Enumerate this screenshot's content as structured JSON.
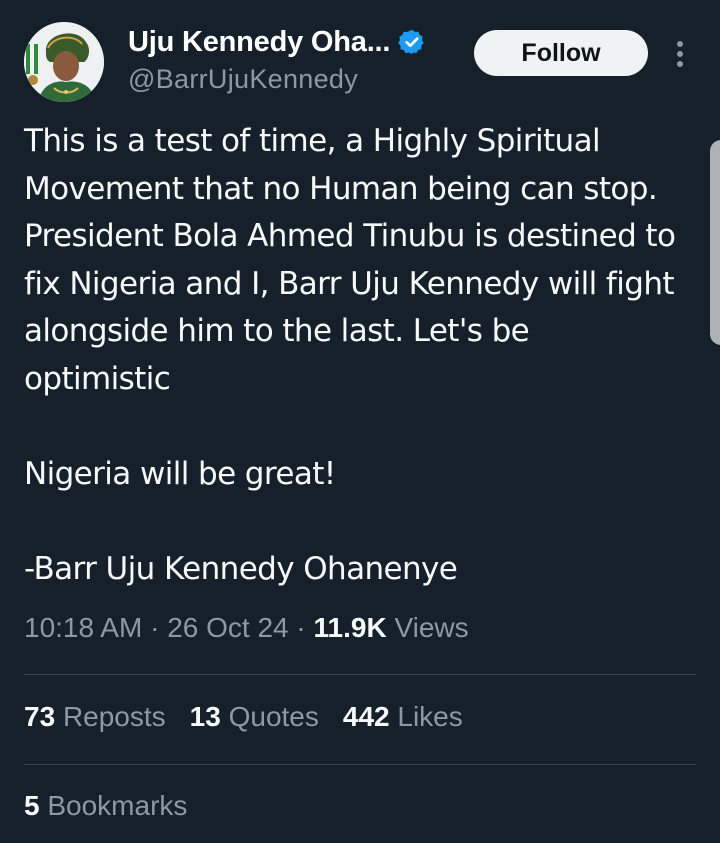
{
  "author": {
    "display_name": "Uju Kennedy Oha...",
    "handle": "@BarrUjuKennedy",
    "verified_icon": "verified-badge-icon",
    "avatar_icon": "avatar-photo"
  },
  "actions": {
    "follow_label": "Follow",
    "more_icon": "more-vertical-icon"
  },
  "tweet": {
    "paragraphs": [
      "This is a test of time, a Highly Spiritual Movement that no Human being can stop. President Bola Ahmed Tinubu is destined to fix Nigeria and I, Barr Uju Kennedy will fight alongside him to the last. Let's be optimistic",
      "Nigeria will be great!",
      "-Barr Uju Kennedy Ohanenye"
    ],
    "time": "10:18 AM",
    "date": "26 Oct 24",
    "separator": "·",
    "views_count": "11.9K",
    "views_label": "Views"
  },
  "stats": {
    "reposts_count": "73",
    "reposts_label": "Reposts",
    "quotes_count": "13",
    "quotes_label": "Quotes",
    "likes_count": "442",
    "likes_label": "Likes",
    "bookmarks_count": "5",
    "bookmarks_label": "Bookmarks"
  },
  "colors": {
    "background": "#15202b",
    "primary_text": "#f7f9f9",
    "secondary_text": "#8b98a5",
    "divider": "#38444d",
    "verified_blue": "#1d9bf0",
    "follow_bg": "#eff3f4"
  }
}
